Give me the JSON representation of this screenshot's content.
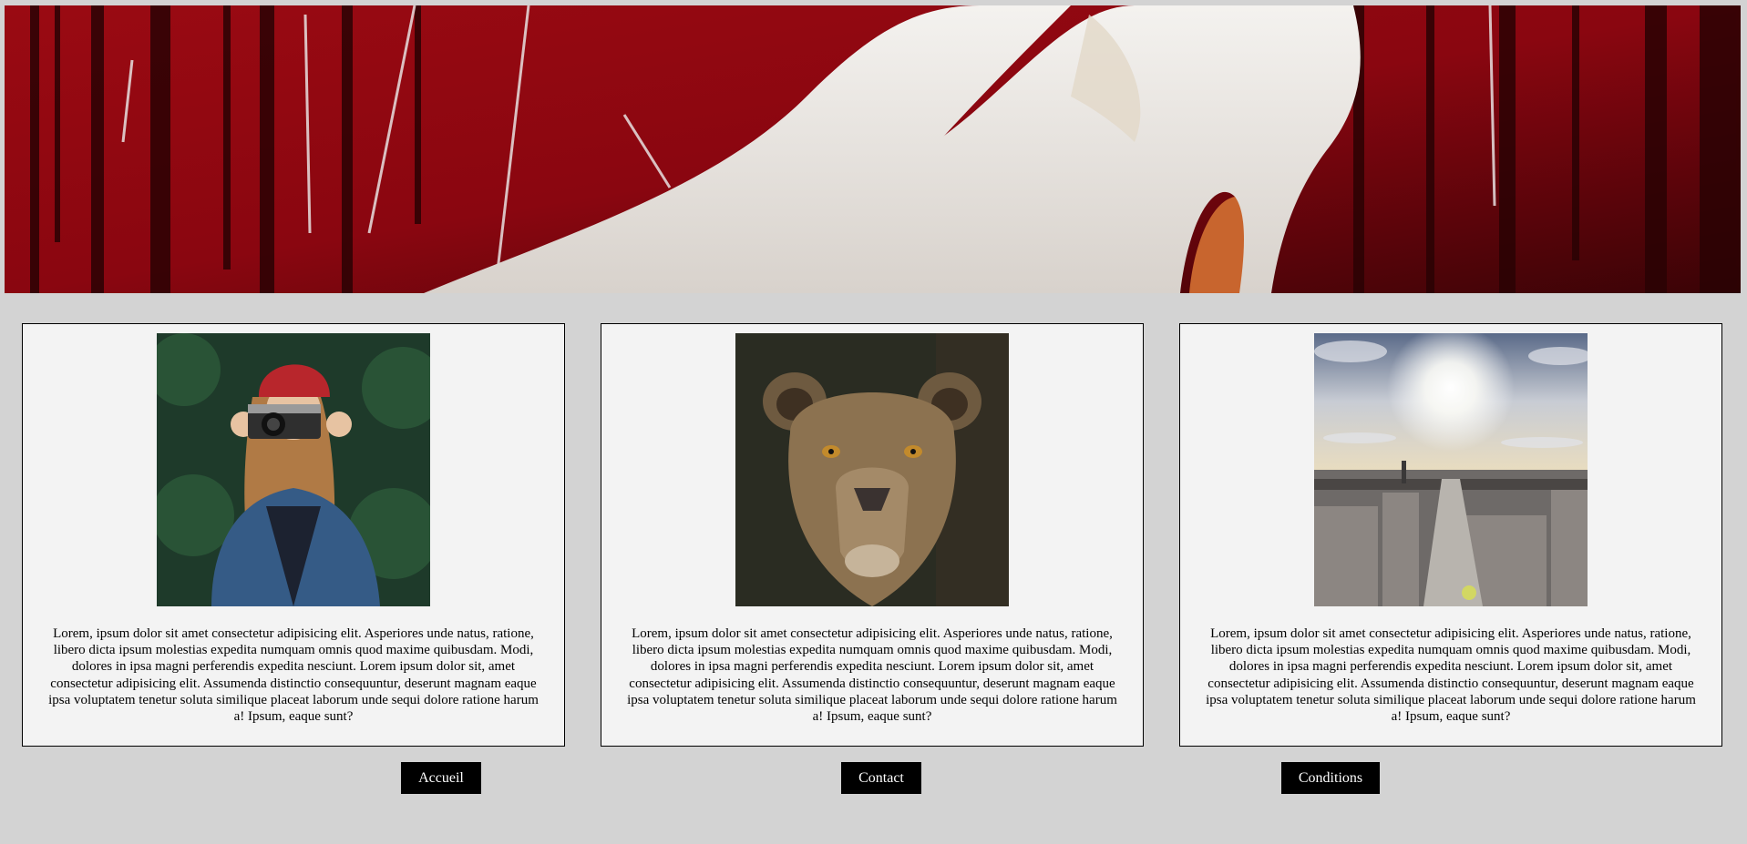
{
  "banner": {
    "image": "white-high-heel-shoes-on-red-paint-background"
  },
  "cards": [
    {
      "image": "woman-red-beanie-holding-camera",
      "text": "Lorem, ipsum dolor sit amet consectetur adipisicing elit. Asperiores unde natus, ratione, libero dicta ipsum molestias expedita numquam omnis quod maxime quibusdam. Modi, dolores in ipsa magni perferendis expedita nesciunt. Lorem ipsum dolor sit, amet consectetur adipisicing elit. Assumenda distinctio consequuntur, deserunt magnam eaque ipsa voluptatem tenetur soluta similique placeat laborum unde sequi dolore ratione harum a! Ipsum, eaque sunt?"
    },
    {
      "image": "lioness-portrait",
      "text": "Lorem, ipsum dolor sit amet consectetur adipisicing elit. Asperiores unde natus, ratione, libero dicta ipsum molestias expedita numquam omnis quod maxime quibusdam. Modi, dolores in ipsa magni perferendis expedita nesciunt. Lorem ipsum dolor sit, amet consectetur adipisicing elit. Assumenda distinctio consequuntur, deserunt magnam eaque ipsa voluptatem tenetur soluta similique placeat laborum unde sequi dolore ratione harum a! Ipsum, eaque sunt?"
    },
    {
      "image": "city-skyline-sunlight",
      "text": "Lorem, ipsum dolor sit amet consectetur adipisicing elit. Asperiores unde natus, ratione, libero dicta ipsum molestias expedita numquam omnis quod maxime quibusdam. Modi, dolores in ipsa magni perferendis expedita nesciunt. Lorem ipsum dolor sit, amet consectetur adipisicing elit. Assumenda distinctio consequuntur, deserunt magnam eaque ipsa voluptatem tenetur soluta similique placeat laborum unde sequi dolore ratione harum a! Ipsum, eaque sunt?"
    }
  ],
  "nav": {
    "accueil": "Accueil",
    "contact": "Contact",
    "conditions": "Conditions"
  },
  "colors": {
    "page_background": "#d3d3d3",
    "card_background": "#f3f3f3",
    "button_background": "#000000",
    "button_text": "#ffffff"
  }
}
